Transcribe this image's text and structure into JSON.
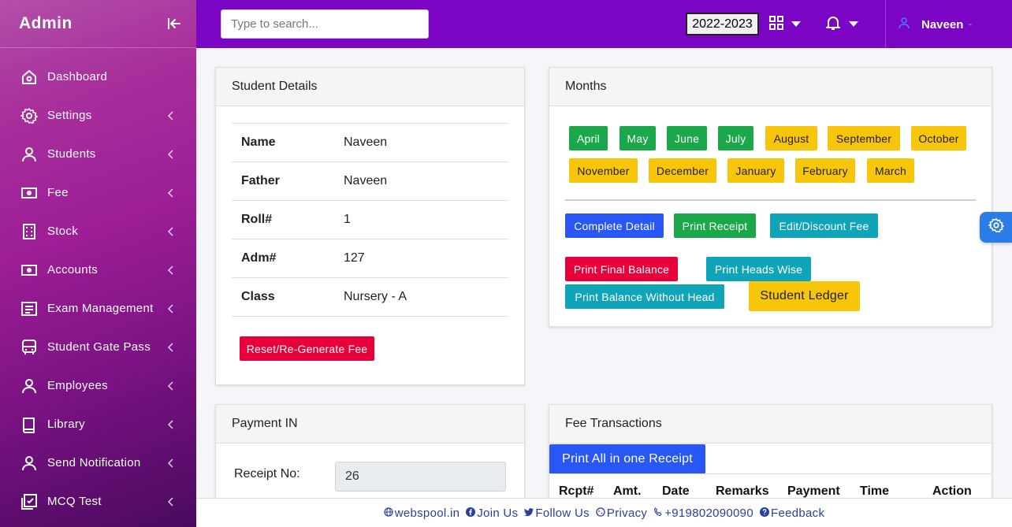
{
  "sidebar": {
    "brand": "Admin",
    "items": [
      {
        "label": "Dashboard",
        "icon": "home-icon",
        "chevron": false
      },
      {
        "label": "Settings",
        "icon": "gear-icon",
        "chevron": true
      },
      {
        "label": "Students",
        "icon": "user-icon",
        "chevron": true
      },
      {
        "label": "Fee",
        "icon": "money-icon",
        "chevron": true
      },
      {
        "label": "Stock",
        "icon": "calculator-icon",
        "chevron": true
      },
      {
        "label": "Accounts",
        "icon": "money-icon",
        "chevron": true
      },
      {
        "label": "Exam Management",
        "icon": "document-icon",
        "chevron": true
      },
      {
        "label": "Student Gate Pass",
        "icon": "bus-icon",
        "chevron": true
      },
      {
        "label": "Employees",
        "icon": "user-icon",
        "chevron": true
      },
      {
        "label": "Library",
        "icon": "book-icon",
        "chevron": true
      },
      {
        "label": "Send Notification",
        "icon": "user-icon",
        "chevron": true
      },
      {
        "label": "MCQ Test",
        "icon": "checklist-icon",
        "chevron": true
      }
    ]
  },
  "topbar": {
    "search_placeholder": "Type to search...",
    "session": "2022-2023",
    "user_name": "Naveen"
  },
  "student_details": {
    "title": "Student Details",
    "rows": [
      {
        "key": "Name",
        "value": "Naveen"
      },
      {
        "key": "Father",
        "value": "Naveen"
      },
      {
        "key": "Roll#",
        "value": "1"
      },
      {
        "key": "Adm#",
        "value": "127"
      },
      {
        "key": "Class",
        "value": "Nursery - A"
      }
    ],
    "reset_button": "Reset/Re-Generate Fee"
  },
  "months": {
    "title": "Months",
    "items": [
      {
        "label": "April",
        "status": "paid"
      },
      {
        "label": "May",
        "status": "paid"
      },
      {
        "label": "June",
        "status": "paid"
      },
      {
        "label": "July",
        "status": "paid"
      },
      {
        "label": "August",
        "status": "pending"
      },
      {
        "label": "September",
        "status": "pending"
      },
      {
        "label": "October",
        "status": "pending"
      },
      {
        "label": "November",
        "status": "pending"
      },
      {
        "label": "December",
        "status": "pending"
      },
      {
        "label": "January",
        "status": "pending"
      },
      {
        "label": "February",
        "status": "pending"
      },
      {
        "label": "March",
        "status": "pending"
      }
    ],
    "actions": {
      "complete_detail": "Complete Detail",
      "print_receipt": "Print Receipt",
      "edit_discount": "Edit/Discount Fee",
      "print_final_balance": "Print Final Balance",
      "print_heads_wise": "Print Heads Wise",
      "print_balance_without_head": "Print Balance Without Head",
      "student_ledger": "Student Ledger"
    }
  },
  "payment_in": {
    "title": "Payment IN",
    "receipt_label": "Receipt No:",
    "receipt_value": "26"
  },
  "fee_transactions": {
    "title": "Fee Transactions",
    "print_all_button": "Print All in one Receipt",
    "columns": [
      "Rcpt#",
      "Amt.",
      "Date",
      "Remarks",
      "Payment",
      "Time",
      "Action"
    ]
  },
  "footer": {
    "website": "webspool.in",
    "join": "Join Us",
    "follow": "Follow Us",
    "privacy": "Privacy",
    "phone": "+919802090090",
    "feedback": "Feedback"
  },
  "colors": {
    "sidebar_top": "#b34fa8",
    "topbar": "#7a05c4",
    "paid": "#1aa84a",
    "pending": "#f7c50a",
    "danger": "#e8003a",
    "primary": "#2957f5",
    "info": "#10a4b8"
  }
}
